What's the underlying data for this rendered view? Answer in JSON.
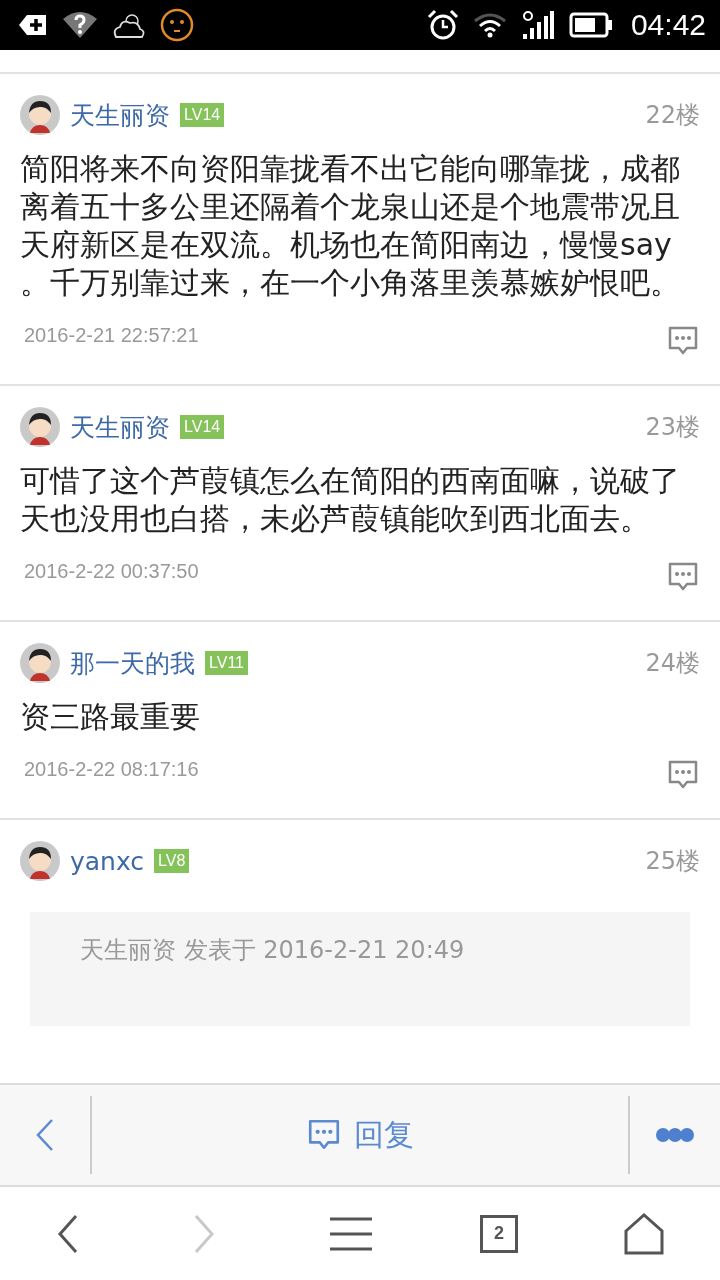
{
  "status_bar": {
    "time": "04:42"
  },
  "posts": [
    {
      "user": "天生丽资",
      "level_badge": "LV14",
      "floor": "22楼",
      "content": "简阳将来不向资阳靠拢看不出它能向哪靠拢，成都离着五十多公里还隔着个龙泉山还是个地震带况且天府新区是在双流。机场也在简阳南边，慢慢say 。千万别靠过来，在一个小角落里羡慕嫉妒恨吧。",
      "time": "2016-2-21 22:57:21"
    },
    {
      "user": "天生丽资",
      "level_badge": "LV14",
      "floor": "23楼",
      "content": "可惜了这个芦葭镇怎么在简阳的西南面嘛，说破了天也没用也白搭，未必芦葭镇能吹到西北面去。",
      "time": "2016-2-22 00:37:50"
    },
    {
      "user": "那一天的我",
      "level_badge": "LV11",
      "floor": "24楼",
      "content": "资三路最重要",
      "time": "2016-2-22 08:17:16"
    },
    {
      "user": "yanxc",
      "level_badge": "LV8",
      "floor": "25楼",
      "quote": {
        "header": "天生丽资 发表于 2016-2-21 20:49"
      }
    }
  ],
  "toolbar": {
    "reply": "回复"
  },
  "nav": [
    {
      "kind": "back",
      "disabled": false
    },
    {
      "kind": "forward",
      "disabled": true
    },
    {
      "kind": "menu",
      "disabled": false
    },
    {
      "kind": "tabs",
      "count": "2",
      "disabled": false
    },
    {
      "kind": "home",
      "disabled": false
    }
  ]
}
